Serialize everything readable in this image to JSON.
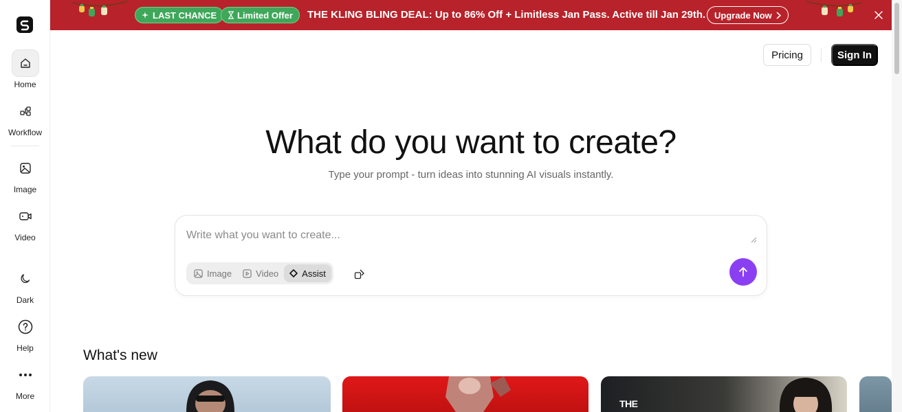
{
  "sidebar": {
    "logo_icon": "logo-s-icon",
    "items": [
      {
        "label": "Home",
        "icon": "home-icon",
        "active": true
      },
      {
        "label": "Workflow",
        "icon": "workflow-icon"
      },
      {
        "label": "Image",
        "icon": "image-icon"
      },
      {
        "label": "Video",
        "icon": "video-icon"
      },
      {
        "label": "Dark",
        "icon": "moon-icon"
      },
      {
        "label": "Help",
        "icon": "help-icon"
      },
      {
        "label": "More",
        "icon": "more-icon"
      }
    ]
  },
  "banner": {
    "badge_last_chance": "LAST CHANCE",
    "badge_limited": "Limited Offer",
    "text": "THE KLING BLING DEAL: Up to 86% Off + Limitless Jan Pass. Active till Jan 29th.",
    "upgrade_label": "Upgrade Now",
    "bg_color": "#b8222a",
    "badge_color": "#3fa75a"
  },
  "header": {
    "pricing_label": "Pricing",
    "signin_label": "Sign In"
  },
  "hero": {
    "title": "What do you want to create?",
    "subtitle": "Type your prompt - turn ideas into stunning AI visuals instantly."
  },
  "prompt": {
    "placeholder": "Write what you want to create...",
    "value": "",
    "modes": [
      {
        "label": "Image",
        "icon": "image-icon"
      },
      {
        "label": "Video",
        "icon": "video-icon"
      },
      {
        "label": "Assist",
        "icon": "sparkle-icon",
        "active": true
      }
    ],
    "send_color": "#8b3ff2"
  },
  "whats_new": {
    "title": "What's new",
    "card3_label": "THE"
  }
}
